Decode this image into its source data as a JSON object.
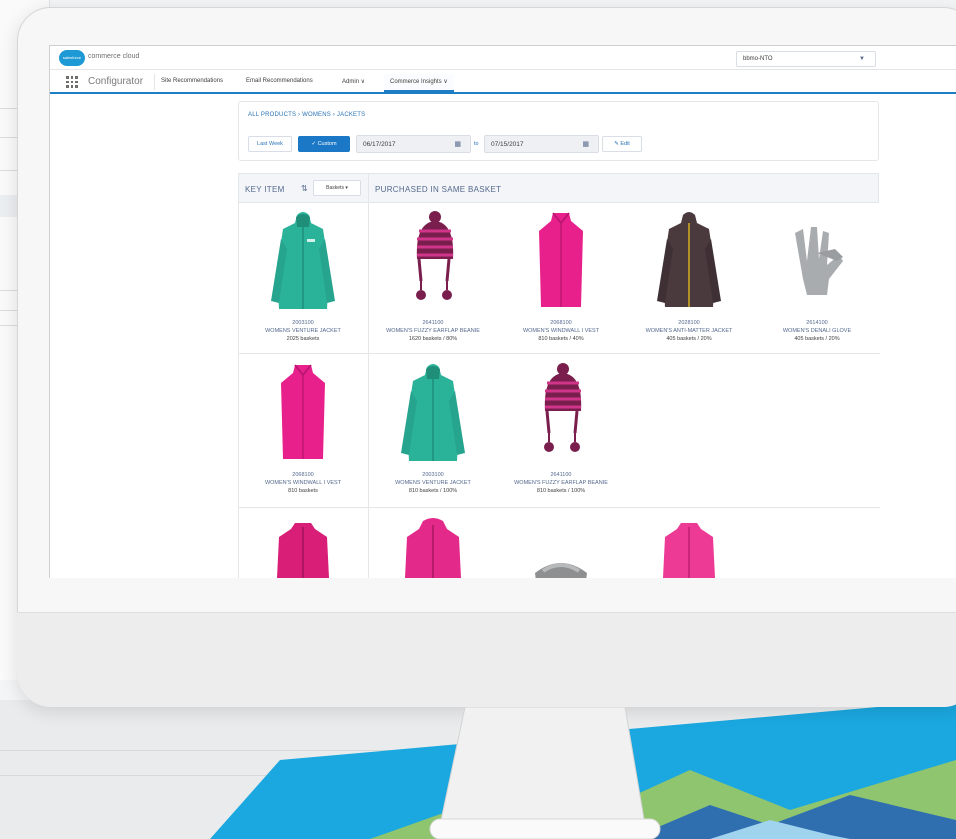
{
  "header": {
    "brand": "commerce cloud",
    "logo_text": "salesforce",
    "site_select": "bbmo-NTO"
  },
  "nav": {
    "app_name": "Configurator",
    "items": [
      {
        "label": "Site Recommendations"
      },
      {
        "label": "Email Recommendations"
      },
      {
        "label": "Admin ∨"
      },
      {
        "label": "Commerce Insights ∨"
      }
    ]
  },
  "filters": {
    "breadcrumb": "ALL PRODUCTS › WOMENS › JACKETS",
    "last_week": "Last Week",
    "custom": "✓ Custom",
    "date_from": "06/17/2017",
    "to_label": "to",
    "date_to": "07/15/2017",
    "edit": "Edit"
  },
  "table": {
    "key_item_header": "KEY ITEM",
    "sort_select": "Baskets ▾",
    "purchased_header": "PURCHASED IN SAME BASKET",
    "rows": [
      {
        "key": {
          "id": "2003100",
          "name": "WOMENS VENTURE JACKET",
          "stat": "2025 baskets"
        },
        "related": [
          {
            "id": "2641100",
            "name": "WOMEN'S FUZZY EARFLAP BEANIE",
            "stat": "1620 baskets / 80%"
          },
          {
            "id": "2068100",
            "name": "WOMEN'S WINDWALL I VEST",
            "stat": "810 baskets / 40%"
          },
          {
            "id": "2028100",
            "name": "WOMEN'S ANTI-MATTER JACKET",
            "stat": "405 baskets / 20%"
          },
          {
            "id": "2614100",
            "name": "WOMEN'S DENALI GLOVE",
            "stat": "405 baskets / 20%"
          }
        ]
      },
      {
        "key": {
          "id": "2068100",
          "name": "WOMEN'S WINDWALL I VEST",
          "stat": "810 baskets"
        },
        "related": [
          {
            "id": "2003100",
            "name": "WOMENS VENTURE JACKET",
            "stat": "810 baskets / 100%"
          },
          {
            "id": "2641100",
            "name": "WOMEN'S FUZZY EARFLAP BEANIE",
            "stat": "810 baskets / 100%"
          }
        ]
      }
    ]
  },
  "colors": {
    "accent": "#1b78c6",
    "teal_jacket": "#2bb39a",
    "pink": "#e8208c",
    "plum_beanie": "#7a1f4d",
    "grey_jacket": "#4a3a3e",
    "glove": "#a9acaf"
  }
}
